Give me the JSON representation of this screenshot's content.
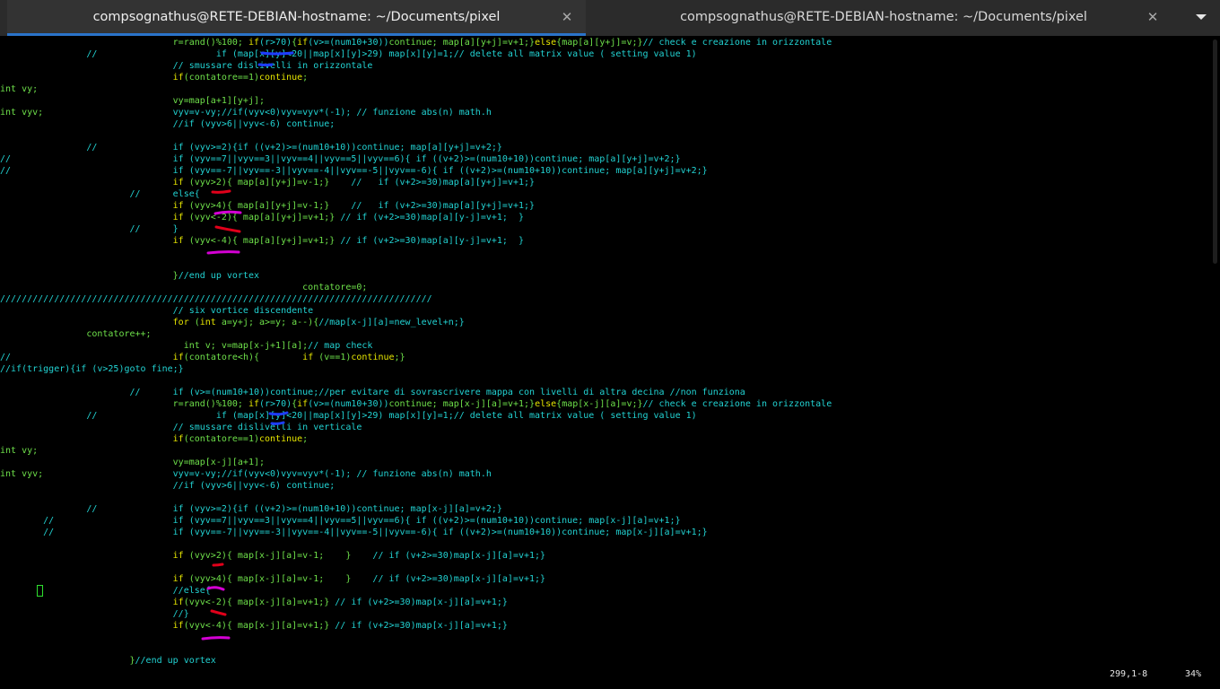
{
  "tabs": [
    {
      "title": "compsognathus@RETE-DEBIAN-hostname: ~/Documents/pixel",
      "active": true,
      "close_icon": "close-icon"
    },
    {
      "title": "compsognathus@RETE-DEBIAN-hostname: ~/Documents/pixel",
      "active": false,
      "close_icon": "close-icon"
    }
  ],
  "tab_close_glyph": "✕",
  "menu_icon": "chevron-down-icon",
  "colors": {
    "background": "#000000",
    "titlebar": "#2b2b2b",
    "active_tab_underline": "#2b73c9",
    "syntax_green": "#6ee04a",
    "syntax_cyan": "#22d3d3",
    "syntax_red": "#d25a5a",
    "syntax_magenta": "#e15ae1",
    "annotation_red": "#e0001a",
    "annotation_magenta": "#d400d4",
    "annotation_blue": "#1e3cff"
  },
  "status": {
    "position": "299,1-8",
    "percent": "34%"
  },
  "code_lines": [
    [
      [
        "g",
        "                                r=rand()%100; "
      ],
      [
        "y",
        "if"
      ],
      [
        "c",
        "(r>70)"
      ],
      [
        "g",
        "{"
      ],
      [
        "y",
        "if"
      ],
      [
        "c",
        "(v>=(num10+30))"
      ],
      [
        "g",
        "continue; map[a][y+j]=v+1;}"
      ],
      [
        "y",
        "else"
      ],
      [
        "g",
        "{map[a][y+j]=v;}"
      ],
      [
        "c",
        "// check e creazione in orizzontale"
      ]
    ],
    [
      [
        "c",
        "                //                      if (map[x][y]<20||map[x][y]>29) map[x][y]=1;// delete all matrix value ( setting value 1)"
      ]
    ],
    [
      [
        "c",
        "                                // smussare dislivelli in orizzontale"
      ]
    ],
    [
      [
        "g",
        "                                "
      ],
      [
        "y",
        "if"
      ],
      [
        "g",
        "(contatore==1)"
      ],
      [
        "y",
        "continue"
      ],
      [
        "g",
        ";"
      ]
    ],
    [
      [
        "g",
        "int vy;"
      ]
    ],
    [
      [
        "g",
        "                                vy=map[a+1][y+j];"
      ]
    ],
    [
      [
        "g",
        "int vyv;                        "
      ],
      [
        "c",
        "vyv=v-vy;//if(vyv<0)vyv=vyv*(-1); // funzione abs(n) math.h"
      ]
    ],
    [
      [
        "c",
        "                                //if (vyv>6||vyv<-6) continue;"
      ]
    ],
    [
      [
        "w",
        ""
      ]
    ],
    [
      [
        "c",
        "                //              if (vyv>=2){if ((v+2)>=(num10+10))continue; map[a][y+j]=v+2;}"
      ]
    ],
    [
      [
        "c",
        "//                              if (vyv==7||vyv==3||vyv==4||vyv==5||vyv==6){ if ((v+2)>=(num10+10))continue; map[a][y+j]=v+2;}"
      ]
    ],
    [
      [
        "c",
        "//                              if (vyv==-7||vyv==-3||vyv==-4||vyv==-5||vyv==-6){ if ((v+2)>=(num10+10))continue; map[a][y+j]=v+2;}"
      ]
    ],
    [
      [
        "g",
        "                                "
      ],
      [
        "y",
        "if"
      ],
      [
        "g",
        " (vyv>2){ map[a][y+j]=v-1;}    "
      ],
      [
        "c",
        "//   if (v+2>=30)map[a][y+j]=v+1;}"
      ]
    ],
    [
      [
        "c",
        "                        //      else{"
      ]
    ],
    [
      [
        "g",
        "                                "
      ],
      [
        "y",
        "if"
      ],
      [
        "g",
        " (vyv>4){ map[a][y+j]=v-1;}    "
      ],
      [
        "c",
        "//   if (v+2>=30)map[a][y+j]=v+1;}"
      ]
    ],
    [
      [
        "g",
        "                                "
      ],
      [
        "y",
        "if"
      ],
      [
        "g",
        " (vyv<-2){ map[a][y+j]=v+1;} "
      ],
      [
        "c",
        "// if (v+2>=30)map[a][y-j]=v+1;  }"
      ]
    ],
    [
      [
        "c",
        "                        //      }"
      ]
    ],
    [
      [
        "g",
        "                                "
      ],
      [
        "y",
        "if"
      ],
      [
        "g",
        " (vyv<-4){ map[a][y+j]=v+1;} "
      ],
      [
        "c",
        "// if (v+2>=30)map[a][y-j]=v+1;  }"
      ]
    ],
    [
      [
        "w",
        ""
      ]
    ],
    [
      [
        "w",
        ""
      ]
    ],
    [
      [
        "g",
        "                                }"
      ],
      [
        "c",
        "//end up vortex"
      ]
    ],
    [
      [
        "g",
        "                                                        contatore=0;"
      ]
    ],
    [
      [
        "c",
        "////////////////////////////////////////////////////////////////////////////////"
      ]
    ],
    [
      [
        "c",
        "                                // six vortice discendente"
      ]
    ],
    [
      [
        "g",
        "                                "
      ],
      [
        "y",
        "for"
      ],
      [
        "g",
        " ("
      ],
      [
        "y",
        "int"
      ],
      [
        "g",
        " a=y+j; a>=y; a--){"
      ],
      [
        "c",
        "//map[x-j][a]=new_level+n;}"
      ]
    ],
    [
      [
        "g",
        "                contatore++;"
      ]
    ],
    [
      [
        "g",
        "                                  int v; v=map[x-j+1][a];"
      ],
      [
        "c",
        "// map check"
      ]
    ],
    [
      [
        "c",
        "//"
      ],
      [
        "g",
        "                              "
      ],
      [
        "y",
        "if"
      ],
      [
        "g",
        "(contatore<h){        "
      ],
      [
        "y",
        "if"
      ],
      [
        "g",
        " (v==1)"
      ],
      [
        "y",
        "continue"
      ],
      [
        "g",
        ";}"
      ]
    ],
    [
      [
        "c",
        "//if(trigger){if (v>25)goto fine;}"
      ]
    ],
    [
      [
        "w",
        ""
      ]
    ],
    [
      [
        "c",
        "                        //      if (v>=(num10+10))continue;//per evitare di sovrascrivere mappa con livelli di altra decina //non funziona"
      ]
    ],
    [
      [
        "g",
        "                                r=rand()%100; "
      ],
      [
        "y",
        "if"
      ],
      [
        "c",
        "(r>70)"
      ],
      [
        "g",
        "{"
      ],
      [
        "y",
        "if"
      ],
      [
        "c",
        "(v>=(num10+30))"
      ],
      [
        "g",
        "continue; map[x-j][a]=v+1;}"
      ],
      [
        "y",
        "else"
      ],
      [
        "g",
        "{map[x-j][a]=v;}"
      ],
      [
        "c",
        "// check e creazione in orizzontale"
      ]
    ],
    [
      [
        "c",
        "                //                      if (map[x][y]<20||map[x][y]>29) map[x][y]=1;// delete all matrix value ( setting value 1)"
      ]
    ],
    [
      [
        "c",
        "                                // smussare dislivelli in verticale"
      ]
    ],
    [
      [
        "g",
        "                                "
      ],
      [
        "y",
        "if"
      ],
      [
        "g",
        "(contatore==1)"
      ],
      [
        "y",
        "continue"
      ],
      [
        "g",
        ";"
      ]
    ],
    [
      [
        "g",
        "int vy;"
      ]
    ],
    [
      [
        "g",
        "                                vy=map[x-j][a+1];"
      ]
    ],
    [
      [
        "g",
        "int vyv;                        "
      ],
      [
        "c",
        "vyv=v-vy;//if(vyv<0)vyv=vyv*(-1); // funzione abs(n) math.h"
      ]
    ],
    [
      [
        "c",
        "                                //if (vyv>6||vyv<-6) continue;"
      ]
    ],
    [
      [
        "w",
        ""
      ]
    ],
    [
      [
        "c",
        "                //              if (vyv>=2){if ((v+2)>=(num10+10))continue; map[x-j][a]=v+2;}"
      ]
    ],
    [
      [
        "c",
        "        //                      if (vyv==7||vyv==3||vyv==4||vyv==5||vyv==6){ if ((v+2)>=(num10+10))continue; map[x-j][a]=v+1;}"
      ]
    ],
    [
      [
        "c",
        "        //                      if (vyv==-7||vyv==-3||vyv==-4||vyv==-5||vyv==-6){ if ((v+2)>=(num10+10))continue; map[x-j][a]=v+1;}"
      ]
    ],
    [
      [
        "w",
        ""
      ]
    ],
    [
      [
        "g",
        "                                "
      ],
      [
        "y",
        "if"
      ],
      [
        "g",
        " (vyv>2){ map[x-j][a]=v-1;    }    "
      ],
      [
        "c",
        "// if (v+2>=30)map[x-j][a]=v+1;}"
      ]
    ],
    [
      [
        "w",
        ""
      ]
    ],
    [
      [
        "g",
        "                                "
      ],
      [
        "y",
        "if"
      ],
      [
        "g",
        " (vyv>4){ map[x-j][a]=v-1;    }    "
      ],
      [
        "c",
        "// if (v+2>=30)map[x-j][a]=v+1;}"
      ]
    ],
    [
      [
        "c",
        "                                //else{"
      ]
    ],
    [
      [
        "g",
        "                                "
      ],
      [
        "y",
        "if"
      ],
      [
        "g",
        "(vyv<-2){ map[x-j][a]=v+1;} "
      ],
      [
        "c",
        "// if (v+2>=30)map[x-j][a]=v+1;}"
      ]
    ],
    [
      [
        "c",
        "                                //}"
      ]
    ],
    [
      [
        "g",
        "                                "
      ],
      [
        "y",
        "if"
      ],
      [
        "g",
        "(vyv<-4){ map[x-j][a]=v+1;} "
      ],
      [
        "c",
        "// if (v+2>=30)map[x-j][a]=v+1;}"
      ]
    ],
    [
      [
        "w",
        ""
      ]
    ],
    [
      [
        "w",
        ""
      ]
    ],
    [
      [
        "g",
        "                        }"
      ],
      [
        "c",
        "//end up vortex"
      ]
    ]
  ]
}
